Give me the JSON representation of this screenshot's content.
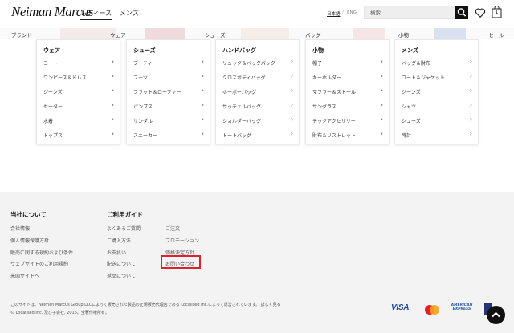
{
  "header": {
    "logo_text": "Neiman Marcus",
    "tabs": [
      {
        "label": "レディース",
        "active": true
      },
      {
        "label": "メンズ",
        "active": false
      }
    ],
    "lang": {
      "jp": "日本語",
      "sep": "/",
      "en": "ENG"
    },
    "search": {
      "placeholder": "検索"
    },
    "bag_count": "1"
  },
  "nav": {
    "items": [
      "ブランド",
      "ウェア",
      "シューズ",
      "バッグ",
      "小物",
      "セール"
    ]
  },
  "menu": {
    "columns": [
      {
        "title": "ウェア",
        "items": [
          "コート",
          "ワンピース＆ドレス",
          "ジーンズ",
          "セーター",
          "水着",
          "トップス"
        ]
      },
      {
        "title": "シューズ",
        "items": [
          "ブーティー",
          "ブーツ",
          "フラット＆ローファー",
          "パンプス",
          "サンダル",
          "スニーカー"
        ]
      },
      {
        "title": "ハンドバッグ",
        "items": [
          "リュック＆バックパック",
          "クロスボディバッグ",
          "ホーボーバッグ",
          "サッチェルバッグ",
          "ショルダーバッグ",
          "トートバッグ"
        ]
      },
      {
        "title": "小物",
        "items": [
          "帽子",
          "キーホルダー",
          "マフラー＆ストール",
          "サングラス",
          "テックアクセサリー",
          "財布＆リストレット"
        ]
      },
      {
        "title": "メンズ",
        "items": [
          "バッグ＆財布",
          "コート＆ジャケット",
          "ジーンズ",
          "シャツ",
          "シューズ",
          "時計"
        ]
      }
    ],
    "chevron": "›"
  },
  "footer": {
    "about": {
      "heading": "当社について",
      "links": [
        "会社情報",
        "個人情報保護方針",
        "販売に関する規約および条件",
        "ウェブサイトのご利用規約",
        "米国サイトへ"
      ]
    },
    "guide": {
      "heading": "ご利用ガイド",
      "col1": [
        "よくあるご質問",
        "ご購入方法",
        "お支払い",
        "配送について",
        "返品について"
      ],
      "col2": [
        "ご注文",
        "プロモーション",
        "価格決定方針",
        "お問い合わせ"
      ]
    },
    "legal_text": "このサイトは、Neiman Marcus Group LLCによって販売された製品の正規販売代理店である Localised Inc.によって運営されています。",
    "legal_link": "詳しく見る",
    "copyright": "© Localised Inc. 及び子会社, 2016。全著作権所有。",
    "payments": {
      "visa": "VISA",
      "amex": "AMERICAN EXPRESS"
    }
  },
  "colors": {
    "highlight": "#e0202f",
    "footer_bg": "#f3f3f3",
    "search_btn": "#111111"
  }
}
